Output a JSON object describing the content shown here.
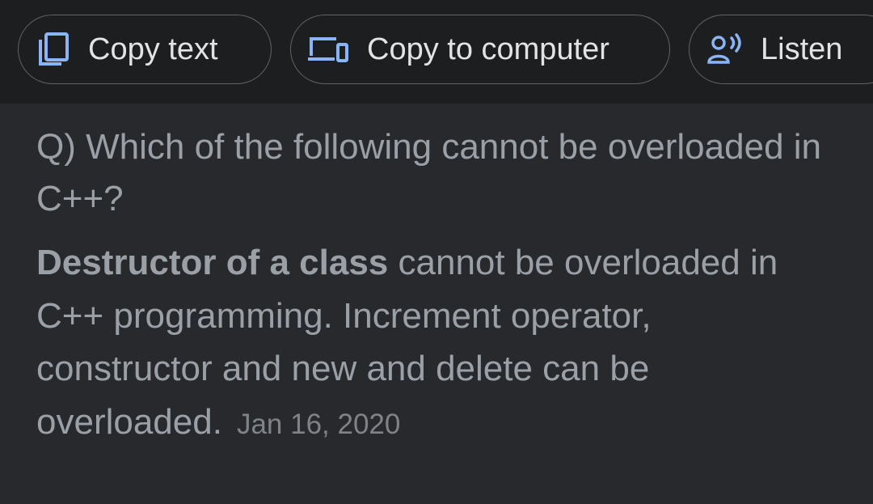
{
  "toolbar": {
    "copy_text": {
      "label": "Copy text",
      "icon": "copy-icon"
    },
    "copy_to_computer": {
      "label": "Copy to computer",
      "icon": "devices-icon"
    },
    "listen": {
      "label": "Listen",
      "icon": "speaker-person-icon"
    },
    "accent_color": "#8ab4f8"
  },
  "question": "Q) Which of the following cannot be overloaded in C++?",
  "answer": {
    "bold": "Destructor of a class",
    "rest": " cannot be overloaded in C++ programming. Increment operator, constructor and new and delete can be overloaded.",
    "date": "Jan 16, 2020"
  }
}
